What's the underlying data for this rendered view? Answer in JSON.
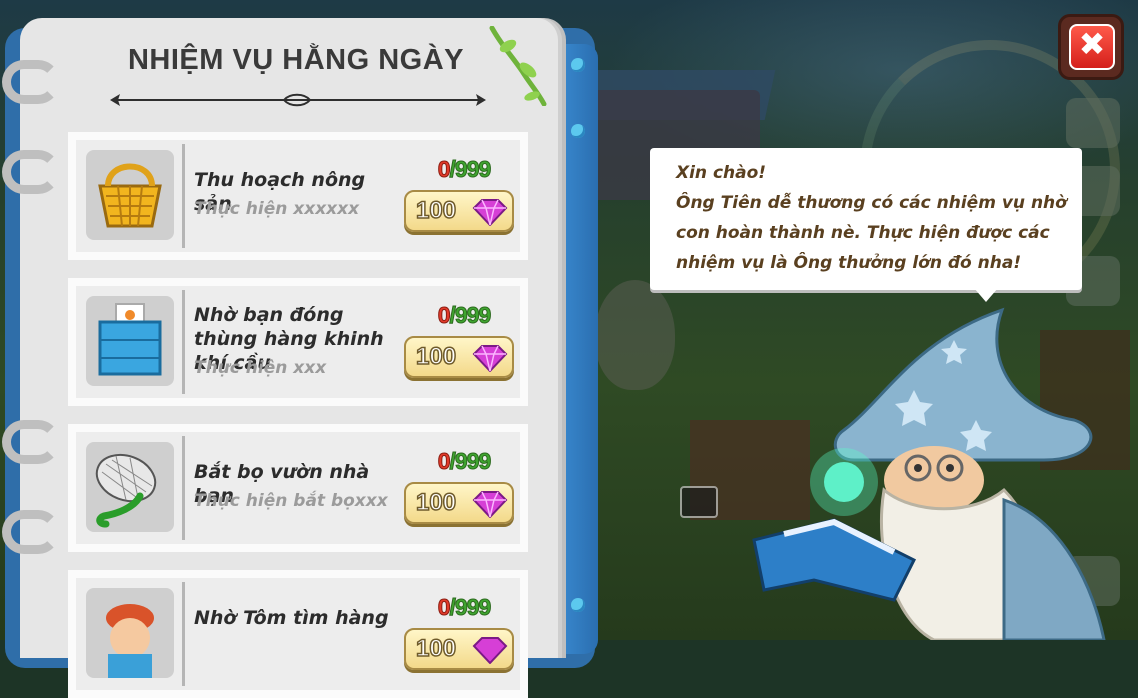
{
  "panel": {
    "title": "NHIỆM VỤ HẰNG NGÀY"
  },
  "tasks": [
    {
      "name": "Thu hoạch nông sản",
      "description": "Thực hiện xxxxxx",
      "progress_current": "0",
      "progress_total": "/999",
      "reward": "100",
      "icon": "basket-icon"
    },
    {
      "name": "Nhờ bạn đóng thùng hàng khinh khí cầu",
      "description": "Thực hiện xxx",
      "progress_current": "0",
      "progress_total": "/999",
      "reward": "100",
      "icon": "crate-icon"
    },
    {
      "name": "Bắt bọ vườn nhà bạn",
      "description": "Thực hiện bắt bọxxx",
      "progress_current": "0",
      "progress_total": "/999",
      "reward": "100",
      "icon": "bug-net-icon"
    },
    {
      "name": "Nhờ Tôm tìm hàng",
      "description": "",
      "progress_current": "0",
      "progress_total": "/999",
      "reward": "100",
      "icon": "tom-character-icon"
    }
  ],
  "reward_icon": "purple-gem-icon",
  "speech": {
    "text": "Xin chào!\nÔng Tiên dễ thương có các nhiệm vụ nhờ con hoàn thành nè. Thực hiện được các nhiệm vụ là Ông thưởng lớn đó nha!"
  },
  "close_button": {
    "symbol": "✖",
    "icon": "close-icon"
  },
  "colors": {
    "progress_current": "#e23a2a",
    "progress_total": "#3fa530",
    "close_red": "#d41f1b",
    "book_blue": "#2f6ea9"
  }
}
